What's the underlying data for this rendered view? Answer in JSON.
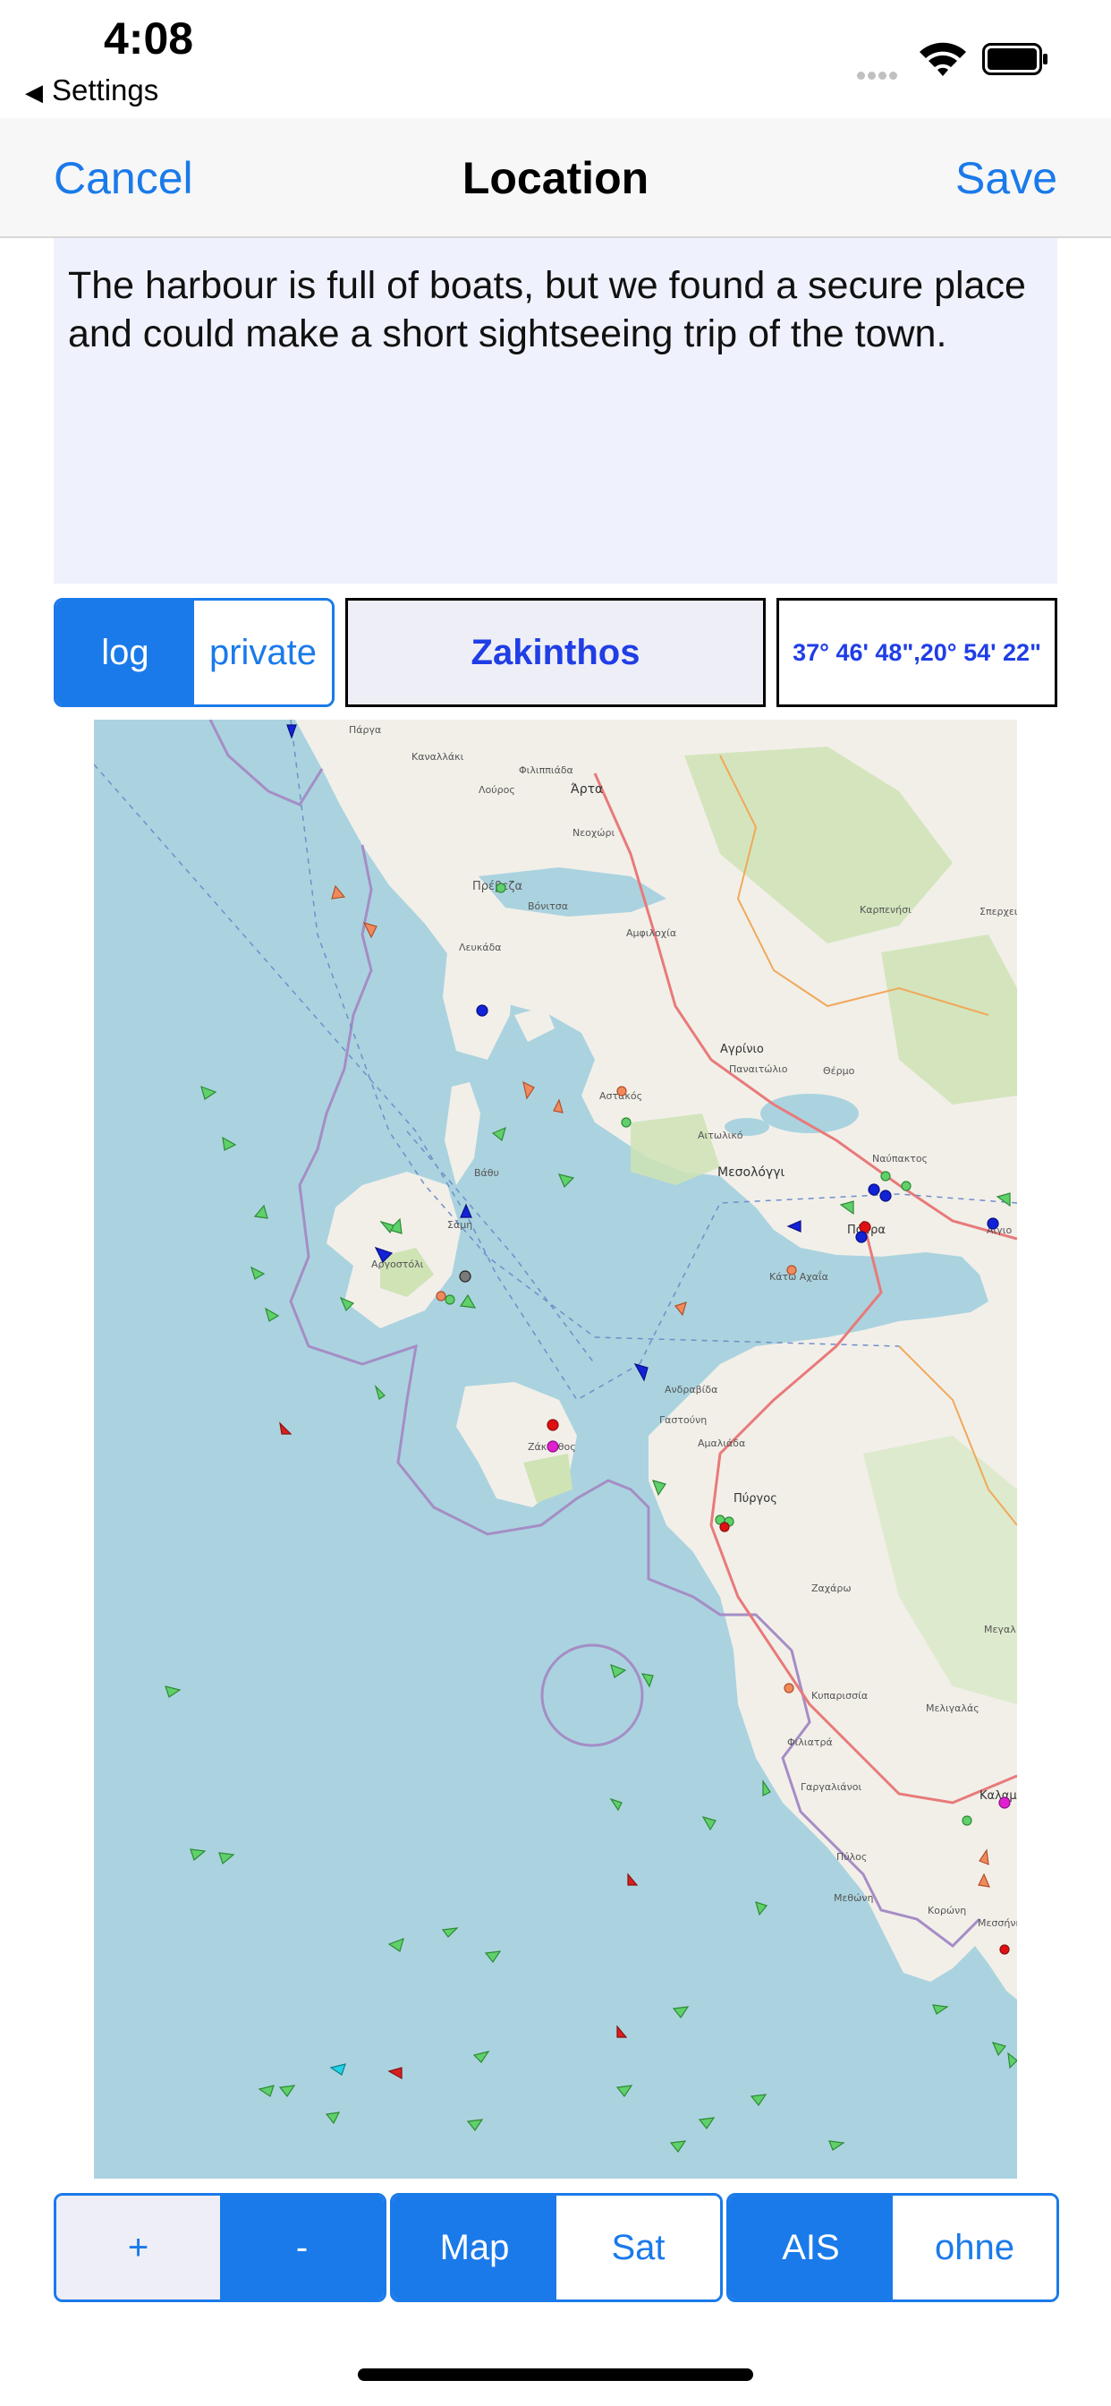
{
  "status_bar": {
    "time": "4:08",
    "back_app": "Settings",
    "back_icon": "back-triangle-icon",
    "wifi_icon": "wifi-icon",
    "battery_icon": "battery-icon"
  },
  "nav": {
    "cancel_label": "Cancel",
    "title": "Location",
    "save_label": "Save"
  },
  "note": {
    "text": "The harbour is full of boats, but we found a secure place and could make a short sightseeing trip of the town."
  },
  "log_type": {
    "options": [
      "log",
      "private"
    ],
    "selected": "log"
  },
  "place": {
    "name": "Zakinthos"
  },
  "coordinates": {
    "text": "37° 46' 48\",20° 54' 22\""
  },
  "map": {
    "labels": [
      "Πάργα",
      "Καναλλάκι",
      "Φιλιππιάδα",
      "Λούρος",
      "Άρτα",
      "Νεοχώρι",
      "Πρέβεζα",
      "Βόνιτσα",
      "Αμφιλοχία",
      "Λευκάδα",
      "Καρπενήσι",
      "Σπερχει",
      "Αγρίνιο",
      "Παναιτώλιο",
      "Θέρμο",
      "Αστακός",
      "Αιτωλικό",
      "Βάθυ",
      "Μεσολόγγι",
      "Ναύπακτος",
      "Αργοστόλι",
      "Σάμη",
      "Πάτρα",
      "Κάτω Αχαΐα",
      "Ανδραβίδα",
      "Γαστούνη",
      "Αμαλιάδα",
      "Ζάκυνθος",
      "Πύργος",
      "Ζαχάρω",
      "Κυπαρισσία",
      "Φιλιατρά",
      "Μελιγαλάς",
      "Γαργαλιάνοι",
      "Καλαμάτα",
      "Πύλος",
      "Μεθώνη",
      "Κορώνη",
      "Μεσσήνη",
      "Μεγαλ",
      "Αίγιο"
    ],
    "colors": {
      "sea": "#aad3df",
      "land": "#f2efe9",
      "forest": "#cfe3b5",
      "border": "#a58dc5"
    }
  },
  "zoom": {
    "in_label": "+",
    "out_label": "-"
  },
  "map_type": {
    "options": [
      "Map",
      "Sat"
    ],
    "selected": "Map"
  },
  "ais": {
    "options": [
      "AIS",
      "ohne"
    ],
    "selected": "AIS"
  }
}
